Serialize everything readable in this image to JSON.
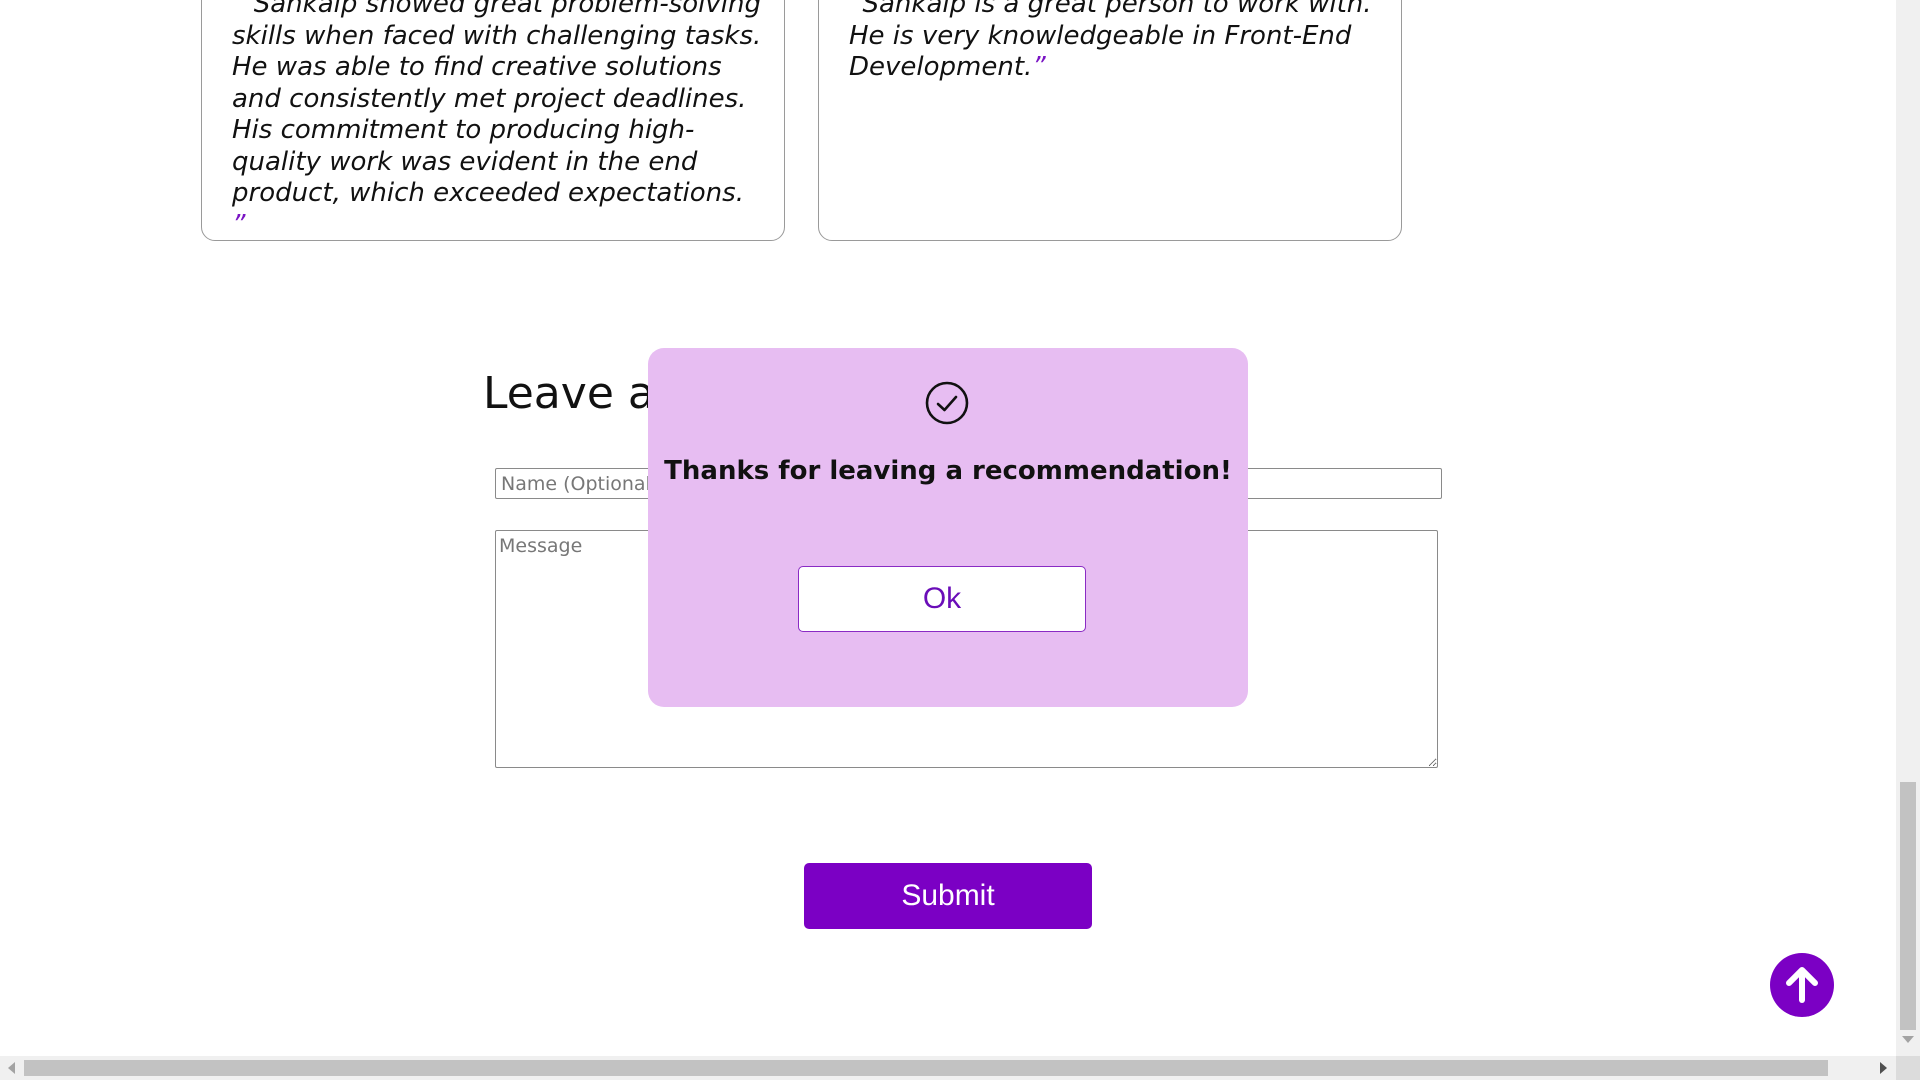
{
  "recommendations": [
    {
      "text": "Sankalp showed great problem-solving skills when faced with challenging tasks. He was able to find creative solutions and consistently met project deadlines. His commitment to producing high-quality work was evident in the end product, which exceeded expectations.",
      "open_quote": "”",
      "close_quote": "”"
    },
    {
      "text": "Sankalp is a great person to work with. He is very knowledgeable in Front-End Development.",
      "open_quote": "”",
      "close_quote": "”"
    }
  ],
  "form": {
    "heading": "Leave a",
    "name_placeholder": "Name (Optional)",
    "message_placeholder": "Message",
    "submit_label": "Submit"
  },
  "modal": {
    "icon": "check-circle-icon",
    "message": "Thanks for leaving a recommendation!",
    "ok_label": "Ok"
  },
  "scroll_top": {
    "icon": "arrow-up-icon"
  },
  "colors": {
    "accent": "#7b00c4",
    "modal_background": "#e7bdf2",
    "quote_mark": "#7a14c4"
  }
}
